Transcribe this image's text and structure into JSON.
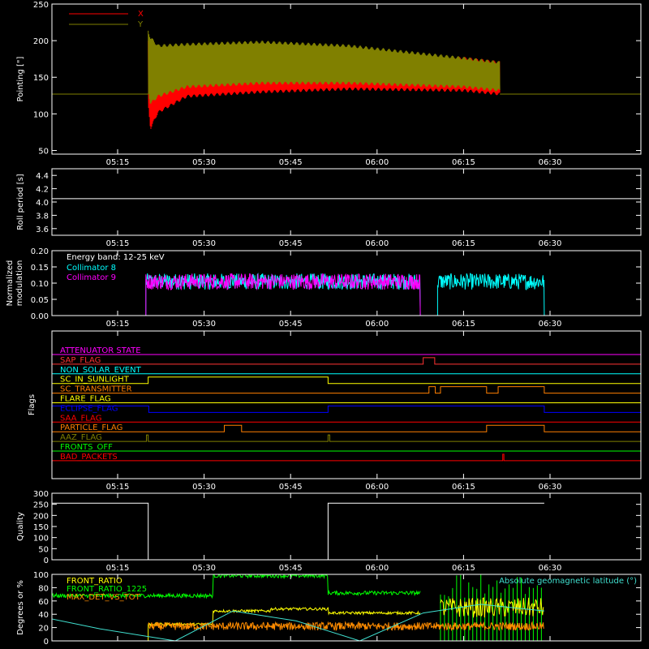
{
  "colors": {
    "background": "#000000",
    "axes": "#ffffff",
    "x_series": "#ff0000",
    "y_series": "#808000",
    "collimator_8": "#00ffff",
    "collimator_9": "#ff00ff",
    "front_ratio": "#ffff00",
    "front_ratio_1225": "#00ff00",
    "max_det": "#ff8c00",
    "geomag": "#40e0d0"
  },
  "chart_data": [
    {
      "id": "pointing",
      "type": "line",
      "ylabel": "Pointing [\"]",
      "ylim": [
        45,
        250
      ],
      "yticks": [
        "50",
        "100",
        "150",
        "200",
        "250"
      ],
      "xticks": [
        "05:15",
        "05:30",
        "05:45",
        "06:00",
        "06:15",
        "06:30"
      ],
      "series": [
        {
          "name": "X",
          "color": "#ff0000",
          "band_t": [
            5.3,
            5.7,
            7,
            12,
            25,
            40,
            60,
            66.3
          ],
          "band_upper": [
            200,
            185,
            165,
            160,
            167,
            172,
            178,
            172
          ],
          "band_lower": [
            110,
            78,
            100,
            122,
            128,
            132,
            130,
            125
          ]
        },
        {
          "name": "Y",
          "color": "#808000",
          "band_t": [
            5.3,
            5.7,
            7,
            12,
            25,
            40,
            60,
            66.3
          ],
          "band_upper": [
            215,
            206,
            195,
            197,
            200,
            195,
            178,
            172
          ],
          "band_lower": [
            128,
            112,
            122,
            135,
            140,
            140,
            135,
            130
          ]
        }
      ],
      "baseline": 127
    },
    {
      "id": "roll",
      "type": "line",
      "ylabel": "Roll period [s]",
      "ylim": [
        3.5,
        4.5
      ],
      "yticks": [
        "3.6",
        "3.8",
        "4.0",
        "4.2",
        "4.4"
      ],
      "xticks": [
        "05:15",
        "05:30",
        "05:45",
        "06:00",
        "06:15",
        "06:30"
      ],
      "value": 4.05
    },
    {
      "id": "modulation",
      "type": "line",
      "ylabel_line1": "Normalized",
      "ylabel_line2": "modulation",
      "ylim": [
        0,
        0.2
      ],
      "yticks": [
        "0.00",
        "0.05",
        "0.10",
        "0.15",
        "0.20"
      ],
      "xticks": [
        "05:15",
        "05:30",
        "05:45",
        "06:00",
        "06:15",
        "06:30"
      ],
      "annotation": "Energy band: 12-25 keV",
      "series": [
        {
          "name": "Collimator 8",
          "color": "#00ffff",
          "mean": 0.105,
          "segments": [
            [
              4.9,
              52.5
            ],
            [
              55.5,
              74
            ]
          ]
        },
        {
          "name": "Collimator 9",
          "color": "#ff00ff",
          "mean": 0.105,
          "segments": [
            [
              4.9,
              52.5
            ]
          ]
        }
      ]
    },
    {
      "id": "flags",
      "type": "step",
      "ylabel": "Flags",
      "xticks": [
        "05:15",
        "05:30",
        "05:45",
        "06:00",
        "06:15",
        "06:30"
      ],
      "flags": [
        {
          "name": "ATTENUATOR STATE",
          "color": "#ff00ff",
          "on": []
        },
        {
          "name": "SAP_FLAG",
          "color": "#ff3333",
          "on": [
            [
              53,
              55
            ]
          ]
        },
        {
          "name": "NON_SOLAR_EVENT",
          "color": "#00ffff",
          "on": []
        },
        {
          "name": "SC_IN_SUNLIGHT",
          "color": "#ffff00",
          "on": [
            [
              5.3,
              36.5
            ]
          ]
        },
        {
          "name": "SC_TRANSMITTER",
          "color": "#ff7f00",
          "on": [
            [
              54,
              55.1
            ],
            [
              56,
              64
            ],
            [
              66,
              74
            ]
          ]
        },
        {
          "name": "FLARE_FLAG",
          "color": "#ffff00",
          "on": []
        },
        {
          "name": "ECLIPSE_FLAG",
          "color": "#0000ff",
          "on": [
            [
              -20,
              5.4
            ],
            [
              36.5,
              74
            ]
          ]
        },
        {
          "name": "SAA_FLAG",
          "color": "#ff0000",
          "on": []
        },
        {
          "name": "PARTICLE_FLAG",
          "color": "#ff7f00",
          "on": [
            [
              18.5,
              21.5
            ],
            [
              64,
              74
            ]
          ]
        },
        {
          "name": "AAZ_FLAG",
          "color": "#808000",
          "on": [
            [
              5,
              5.3
            ],
            [
              36.5,
              36.8
            ]
          ]
        },
        {
          "name": "FRONTS_OFF",
          "color": "#00ff00",
          "on": []
        },
        {
          "name": "BAD_PACKETS",
          "color": "#ff0000",
          "on": [
            [
              66.8,
              67
            ]
          ]
        }
      ]
    },
    {
      "id": "quality",
      "type": "step",
      "ylabel": "Quality",
      "ylim": [
        0,
        300
      ],
      "yticks": [
        "0",
        "50",
        "100",
        "150",
        "200",
        "250",
        "300"
      ],
      "xticks": [
        "05:15",
        "05:30",
        "05:45",
        "06:00",
        "06:15",
        "06:30"
      ],
      "x": [
        -20,
        5.3,
        5.3,
        36.5,
        36.5,
        74
      ],
      "y": [
        255,
        255,
        0,
        0,
        255,
        255
      ]
    },
    {
      "id": "ratios",
      "type": "line",
      "ylabel": "Degrees or %",
      "ylim": [
        0,
        100
      ],
      "yticks": [
        "0",
        "20",
        "40",
        "60",
        "80",
        "100"
      ],
      "legend_left": [
        "FRONT_RATIO",
        "FRONT_RATIO_1225",
        "MAX_DET_VS_TOT"
      ],
      "legend_right": "Absolute geomagnetic latitude (°)",
      "series": [
        {
          "name": "FRONT_RATIO",
          "color": "#ffff00",
          "steps": [
            [
              5.3,
              25
            ],
            [
              16.5,
              45
            ],
            [
              26.5,
              48
            ],
            [
              36.5,
              42
            ],
            [
              52.5,
              40
            ]
          ]
        },
        {
          "name": "FRONT_RATIO_1225",
          "color": "#00ff00",
          "steps": [
            [
              -20,
              68
            ],
            [
              16.5,
              98
            ],
            [
              36.5,
              72
            ],
            [
              52.5,
              68
            ]
          ]
        },
        {
          "name": "MAX_DET_VS_TOT",
          "color": "#ff8c00",
          "level": 22
        }
      ],
      "geomag": {
        "t": [
          -20,
          -3,
          10,
          20,
          31,
          42,
          53,
          63,
          74
        ],
        "v": [
          48,
          18,
          0,
          45,
          30,
          0,
          42,
          55,
          45
        ]
      }
    }
  ]
}
